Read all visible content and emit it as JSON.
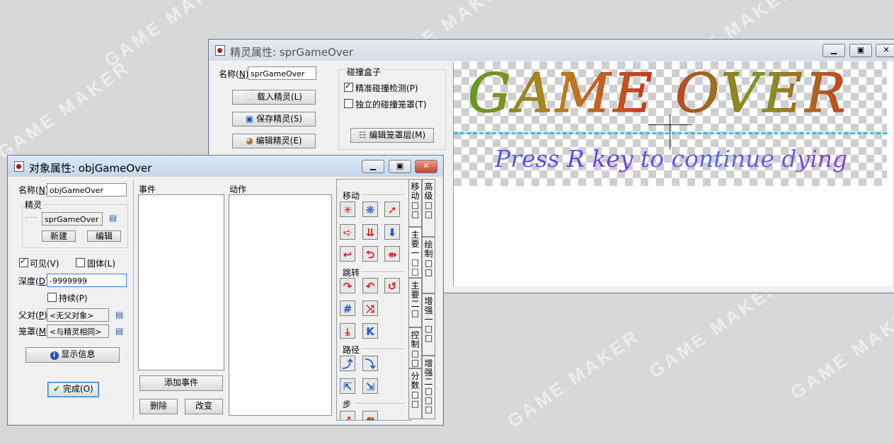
{
  "watermark": "GAME MAKER",
  "sprite_window": {
    "title": "精灵属性: sprGameOver",
    "name_label": "名称",
    "name_value": "sprGameOver",
    "load_button": "载入精灵(L)",
    "save_button": "保存精灵(S)",
    "edit_button": "编辑精灵(E)",
    "collision_box_title": "碰撞盒子",
    "precise_collision_label": "精准碰撞检测(P)",
    "separate_masks_label": "独立的碰撞笼罩(T)",
    "edit_mask_button": "编辑笼罩层(M)",
    "preview": {
      "line1": "GAME OVER",
      "line2": "Press R key to continue dying"
    }
  },
  "object_window": {
    "title": "对象属性: objGameOver",
    "name_label": "名称",
    "name_value": "objGameOver",
    "sprite_group_label": "精灵",
    "sprite_value": "sprGameOver",
    "new_button": "新建",
    "edit_button": "编辑",
    "visible_label": "可见(V)",
    "solid_label": "固体(L)",
    "depth_label": "深度",
    "depth_value": "-9999999",
    "persistent_label": "持续(P)",
    "parent_label": "父对",
    "parent_value": "<无父对象>",
    "mask_label": "笼罩",
    "mask_value": "<与精灵相同>",
    "show_info_button": "显示信息",
    "ok_button": "完成(O)",
    "events_header": "事件",
    "actions_header": "动作",
    "add_event_button": "添加事件",
    "delete_button": "删除",
    "change_button": "改变",
    "section_move": "移动",
    "section_jump": "跳转",
    "section_path": "路径",
    "section_step": "步",
    "tabs_left": [
      "移动",
      "主要一",
      "主要二",
      "控制",
      "分数"
    ],
    "tabs_right": [
      "高级",
      "绘制",
      "增强一",
      "增强二"
    ]
  }
}
